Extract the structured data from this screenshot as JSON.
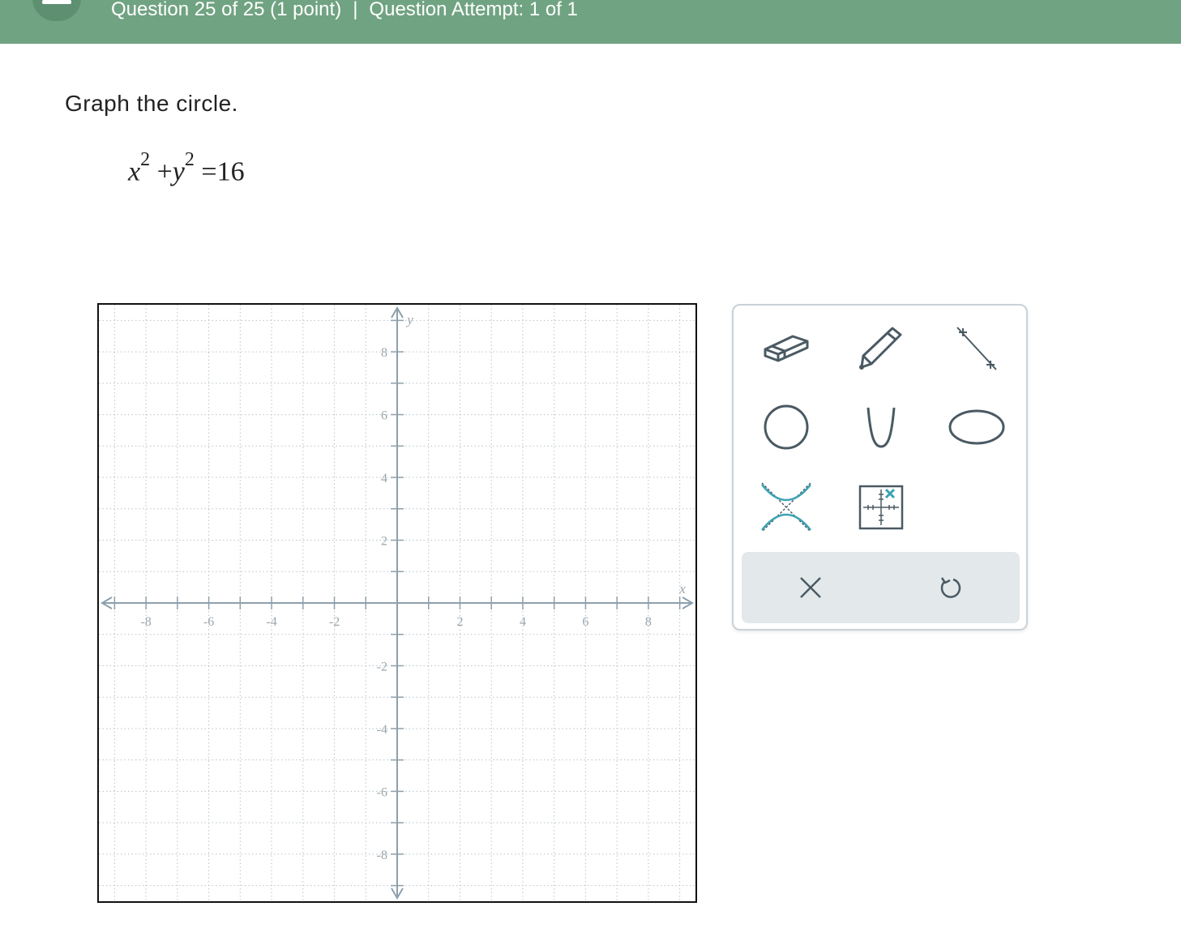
{
  "header": {
    "question_label": "Question 25 of 25 (1 point)",
    "separator": "|",
    "attempt_label": "Question Attempt: 1 of 1"
  },
  "prompt": {
    "instruction": "Graph the circle.",
    "equation": {
      "x_var": "x",
      "x_exp": "2",
      "plus": "+",
      "y_var": "y",
      "y_exp": "2",
      "equals": "=",
      "rhs": "16"
    }
  },
  "graph": {
    "x_axis_label": "x",
    "y_axis_label": "y",
    "x_range": [
      -9.5,
      9.5
    ],
    "y_range": [
      -9.5,
      9.5
    ],
    "x_ticks": [
      "-8",
      "-6",
      "-4",
      "-2",
      "2",
      "4",
      "6",
      "8"
    ],
    "y_ticks": [
      "8",
      "6",
      "4",
      "2",
      "-2",
      "-4",
      "-6",
      "-8"
    ],
    "grid": "dotted",
    "colors": {
      "axis": "#8ea0ab",
      "grid": "#b9c3c9",
      "tick_label": "#9aa6ad"
    }
  },
  "toolbox": {
    "tools": [
      {
        "id": "eraser",
        "icon": "eraser-icon"
      },
      {
        "id": "pencil",
        "icon": "pencil-icon"
      },
      {
        "id": "line",
        "icon": "line-segment-icon"
      },
      {
        "id": "circle",
        "icon": "circle-icon"
      },
      {
        "id": "parabola",
        "icon": "parabola-icon"
      },
      {
        "id": "ellipse",
        "icon": "ellipse-icon"
      },
      {
        "id": "hyperbola",
        "icon": "hyperbola-icon"
      },
      {
        "id": "no-solution",
        "icon": "no-solution-grid-icon"
      }
    ],
    "actions": [
      {
        "id": "clear",
        "icon": "close-icon"
      },
      {
        "id": "undo",
        "icon": "undo-icon"
      }
    ],
    "colors": {
      "icon": "#4a5a63",
      "accent": "#3aa3b3",
      "bar": "#e3e8eb"
    }
  }
}
